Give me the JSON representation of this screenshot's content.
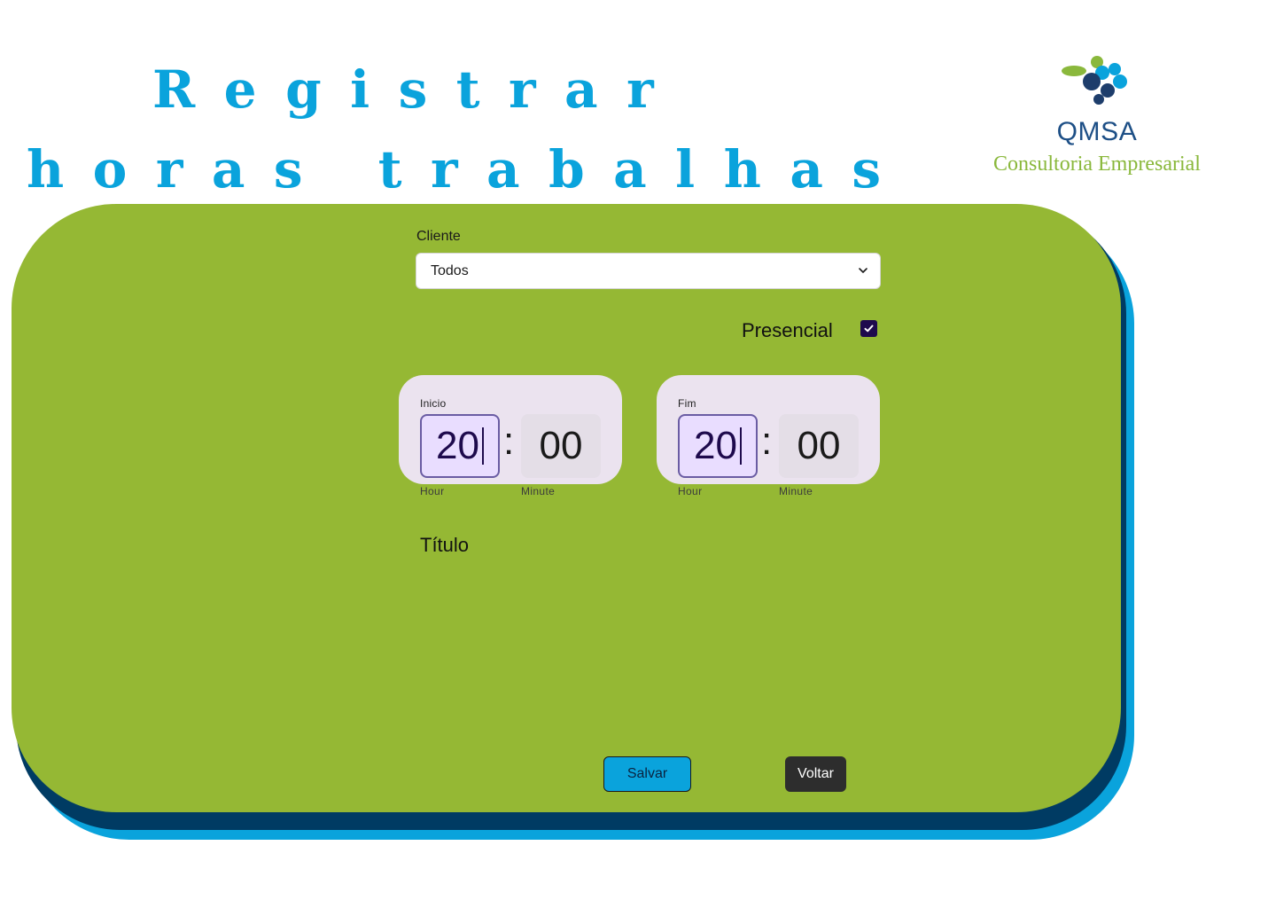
{
  "header": {
    "title_line1": "Registrar",
    "title_line2": "horas trabalhas",
    "title_color": "#0aa3dc"
  },
  "logo": {
    "name": "QMSA",
    "subtitle": "Consultoria Empresarial",
    "icon": "qmsa-logo-icon"
  },
  "form": {
    "client_label": "Cliente",
    "client_value": "Todos",
    "presencial_label": "Presencial",
    "presencial_checked": true,
    "start": {
      "label": "Inicio",
      "hour": "20",
      "minute": "00",
      "hour_label": "Hour",
      "minute_label": "Minute",
      "separator": ":"
    },
    "end": {
      "label": "Fim",
      "hour": "20",
      "minute": "00",
      "hour_label": "Hour",
      "minute_label": "Minute",
      "separator": ":"
    },
    "title_label": "Título"
  },
  "actions": {
    "save_label": "Salvar",
    "back_label": "Voltar"
  },
  "colors": {
    "card_green": "#95b834",
    "layer_navy": "#003b63",
    "layer_cyan": "#0aa3dc",
    "checkbox": "#1e0a4d"
  }
}
